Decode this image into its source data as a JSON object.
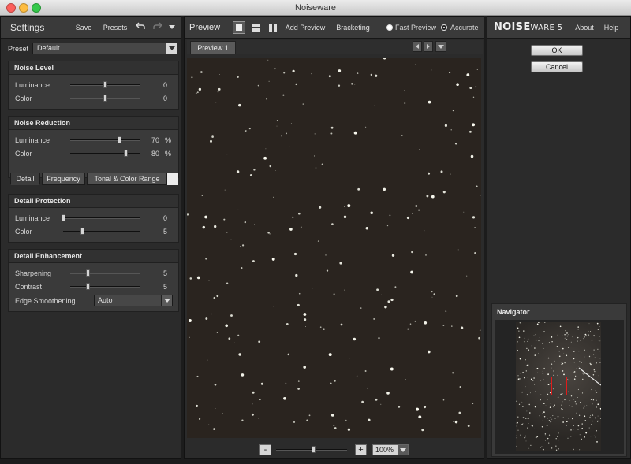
{
  "window": {
    "title": "Noiseware"
  },
  "settings": {
    "title": "Settings",
    "save_label": "Save",
    "presets_label": "Presets",
    "preset_label": "Preset",
    "preset_value": "Default",
    "noise_level": {
      "title": "Noise Level",
      "luminance": {
        "label": "Luminance",
        "value": "0",
        "level": 0.5
      },
      "color": {
        "label": "Color",
        "value": "0",
        "level": 0.5
      }
    },
    "noise_reduction": {
      "title": "Noise Reduction",
      "luminance": {
        "label": "Luminance",
        "value": "70",
        "unit": "%",
        "level": 0.7
      },
      "color": {
        "label": "Color",
        "value": "80",
        "unit": "%",
        "level": 0.8
      }
    },
    "tabs": [
      "Detail",
      "Frequency",
      "Tonal & Color Range"
    ],
    "detail_protection": {
      "title": "Detail Protection",
      "luminance": {
        "label": "Luminance",
        "value": "0",
        "level": 0.0
      },
      "color": {
        "label": "Color",
        "value": "5",
        "level": 0.25
      }
    },
    "detail_enhancement": {
      "title": "Detail Enhancement",
      "sharpening": {
        "label": "Sharpening",
        "value": "5",
        "level": 0.25
      },
      "contrast": {
        "label": "Contrast",
        "value": "5",
        "level": 0.25
      },
      "edge_smoothening": {
        "label": "Edge Smoothening",
        "value": "Auto"
      }
    }
  },
  "preview": {
    "title": "Preview",
    "add_preview_label": "Add Preview",
    "bracketing_label": "Bracketing",
    "fast_preview_label": "Fast Preview",
    "accurate_label": "Accurate",
    "tab_label": "Preview 1",
    "zoom_minus": "-",
    "zoom_plus": "+",
    "zoom_value": "100%"
  },
  "right": {
    "logo_main": "NOISE",
    "logo_rest": "WARE 5",
    "about_label": "About",
    "help_label": "Help",
    "ok_label": "OK",
    "cancel_label": "Cancel",
    "navigator_title": "Navigator"
  },
  "colors": {
    "accent_red": "#e01b1b",
    "panel": "#2b2b2b",
    "section": "#3a3a3a",
    "star_bg": "#2a241f"
  }
}
